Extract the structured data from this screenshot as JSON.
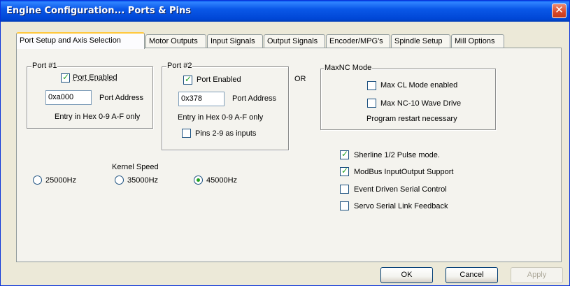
{
  "window": {
    "title": "Engine Configuration... Ports & Pins"
  },
  "tabs": [
    {
      "label": "Port Setup and Axis Selection",
      "active": true
    },
    {
      "label": "Motor Outputs"
    },
    {
      "label": "Input Signals"
    },
    {
      "label": "Output Signals"
    },
    {
      "label": "Encoder/MPG's"
    },
    {
      "label": "Spindle Setup"
    },
    {
      "label": "Mill Options"
    }
  ],
  "port1": {
    "title": "Port #1",
    "enabled_label": "Port Enabled",
    "enabled": true,
    "address_value": "0xa000",
    "address_label": "Port Address",
    "hint": "Entry in Hex 0-9 A-F only"
  },
  "port2": {
    "title": "Port #2",
    "enabled_label": "Port Enabled",
    "enabled": true,
    "address_value": "0x378",
    "address_label": "Port Address",
    "hint": "Entry in Hex 0-9 A-F only",
    "pins_label": "Pins 2-9 as inputs",
    "pins_checked": false
  },
  "or_label": "OR",
  "maxnc": {
    "title": "MaxNC Mode",
    "cl_label": "Max CL Mode enabled",
    "cl_checked": false,
    "nc10_label": "Max NC-10 Wave Drive",
    "nc10_checked": false,
    "note": "Program restart necessary"
  },
  "kernel": {
    "label": "Kernel Speed",
    "options": [
      {
        "label": "25000Hz",
        "selected": false
      },
      {
        "label": "35000Hz",
        "selected": false
      },
      {
        "label": "45000Hz",
        "selected": true
      }
    ]
  },
  "options": [
    {
      "label": "Sherline 1/2 Pulse mode.",
      "checked": true
    },
    {
      "label": "ModBus InputOutput Support",
      "checked": true
    },
    {
      "label": "Event Driven Serial Control",
      "checked": false
    },
    {
      "label": "Servo Serial Link Feedback",
      "checked": false
    }
  ],
  "buttons": {
    "ok": "OK",
    "cancel": "Cancel",
    "apply": "Apply"
  },
  "icons": {
    "close": "close-icon"
  },
  "colors": {
    "titlebar": "#0054e3",
    "close": "#d9482a",
    "check": "#21a121",
    "face": "#ece9d8"
  }
}
